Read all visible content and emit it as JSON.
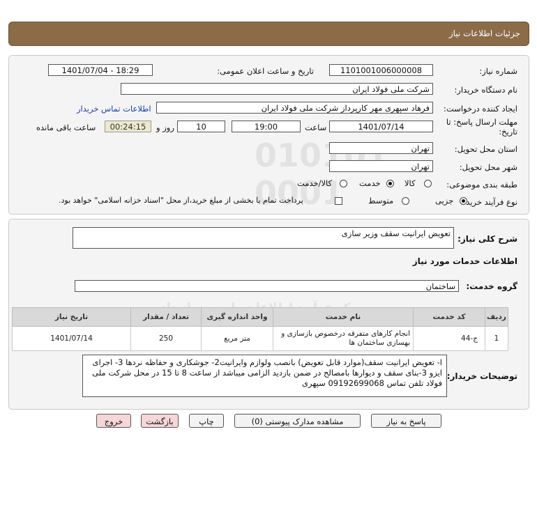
{
  "header": {
    "title": "جزئیات اطلاعات نیاز"
  },
  "fields": {
    "need_number_label": "شماره نیاز:",
    "need_number": "1101001006000008",
    "announce_label": "تاریخ و ساعت اعلان عمومی:",
    "announce_value": "1401/07/04 - 18:29",
    "buyer_org_label": "نام دستگاه خریدار:",
    "buyer_org": "شرکت ملی فولاد ایران",
    "requester_label": "ایجاد کننده درخواست:",
    "requester": "فرهاد سپهری مهر کارپرداز شرکت ملی فولاد ایران",
    "contact_link": "اطلاعات تماس خریدار",
    "deadline_label_1": "مهلت ارسال پاسخ: تا",
    "deadline_label_2": "تاریخ:",
    "deadline_date": "1401/07/14",
    "time_label": "ساعت",
    "deadline_time": "19:00",
    "days_value": "10",
    "days_label": "روز و",
    "remaining_time": "00:24:15",
    "remaining_label": "ساعت باقی مانده",
    "province_label": "استان محل تحویل:",
    "province": "تهران",
    "city_label": "شهر محل تحویل:",
    "city": "تهران",
    "category_label": "طبقه بندی موضوعی:",
    "category_options": [
      "کالا",
      "خدمت",
      "کالا/خدمت"
    ],
    "category_selected": "خدمت",
    "purchase_type_label": "نوع فرآیند خرید :",
    "purchase_options": [
      "جزیی",
      "متوسط"
    ],
    "purchase_selected": "جزیی",
    "treasury_note": "پرداخت تمام یا بخشی از مبلغ خرید،از محل \"اسناد خزانه اسلامی\" خواهد بود."
  },
  "summary": {
    "label": "شرح کلی نیاز:",
    "value": "تعویض ایرانیت سقف وزیر سازی"
  },
  "services": {
    "heading": "اطلاعات خدمات مورد نیاز",
    "group_label": "گروه خدمت:",
    "group_value": "ساختمان",
    "columns": [
      "ردیف",
      "کد خدمت",
      "نام خدمت",
      "واحد اندازه گیری",
      "تعداد / مقدار",
      "تاریخ نیاز"
    ],
    "rows": [
      [
        "1",
        "ج-44",
        "انجام کارهای متفرقه درخصوص بازسازی و بهسازی ساختمان ها",
        "متر مربع",
        "250",
        "1401/07/14"
      ]
    ]
  },
  "buyer_notes": {
    "label": "توضیحات خریدار:",
    "text": "ا- تعویض ایرانیت سقف(موارد قابل تعویض)  بانصب ولوازم وایرانیت2- جوشکاری و حفاظه نردها 3- اجرای ایزو 3-بنای سقف و دیوارها بامصالح در ضمن بازدید الزامی میباشد از ساعت 8 تا 15 در محل شرکت ملی فولاد تلفن تماس 09192699068 سپهری"
  },
  "buttons": {
    "reply": "پاسخ به نیاز",
    "attachments": "مشاهده مدارک پیوستی (0)",
    "print": "چاپ",
    "back": "بازگشت",
    "exit": "خروج"
  },
  "watermark": {
    "line1": "ParsNamadData",
    "line2": "مرکز فرآیند اطلاعات پارس نماد داده",
    "line3": "پایگاه اطلاع رسانی مناقصه و مزایده"
  }
}
